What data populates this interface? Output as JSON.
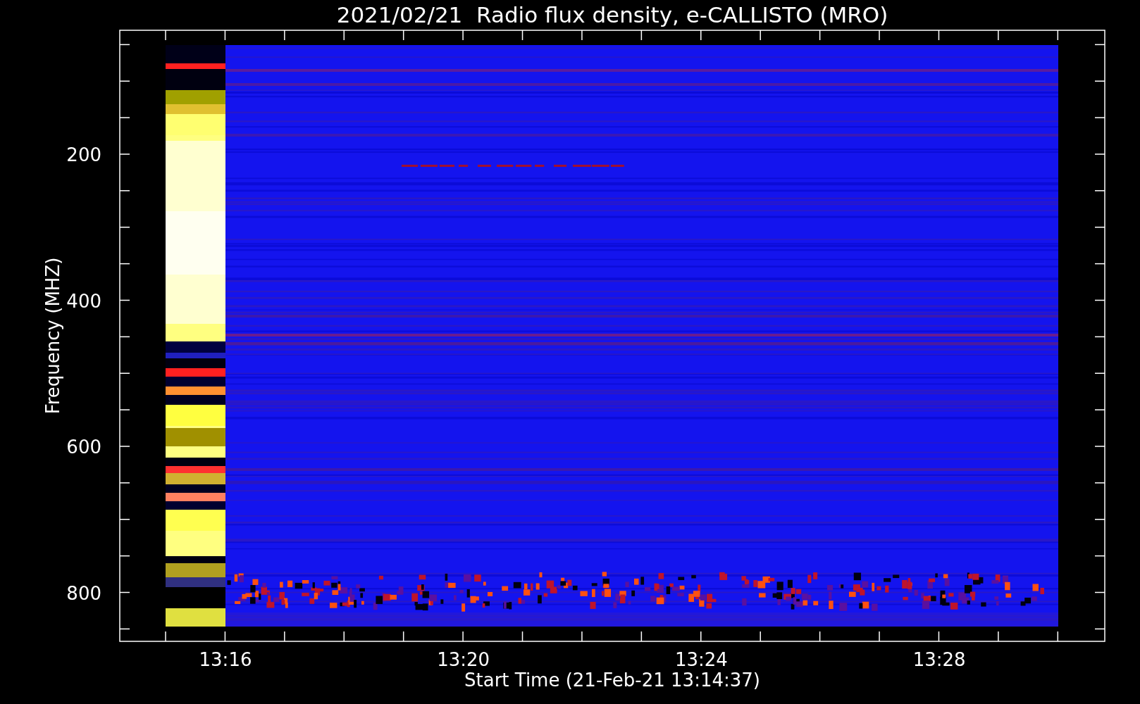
{
  "title": "2021/02/21  Radio flux density, e-CALLISTO (MRO)",
  "y_axis": {
    "label": "Frequency (MHZ)",
    "ticks": [
      "200",
      "400",
      "600",
      "800"
    ]
  },
  "x_axis": {
    "label": "Start Time (21-Feb-21 13:14:37)",
    "ticks": [
      "13:16",
      "13:20",
      "13:24",
      "13:28"
    ]
  }
}
